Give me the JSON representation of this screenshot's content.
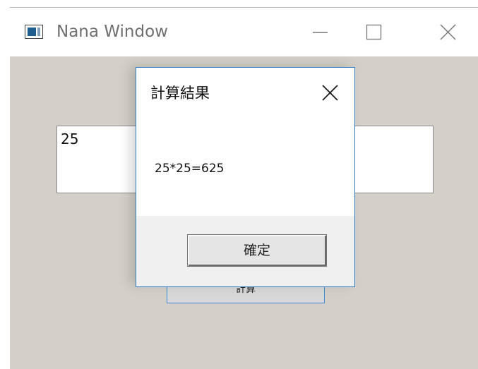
{
  "window": {
    "title": "Nana Window"
  },
  "main": {
    "input_value": "25",
    "button_label": "計算"
  },
  "dialog": {
    "title": "計算結果",
    "message": "25*25=625",
    "ok_label": "確定"
  },
  "colors": {
    "client_background": "#d4d0c8",
    "dialog_border": "#2f7ec4",
    "focused_button_border": "#3c8ad6"
  },
  "icons": {
    "app": "window-icon",
    "minimize": "minimize-icon",
    "maximize": "maximize-icon",
    "close": "close-icon",
    "dialog_close": "close-icon"
  }
}
